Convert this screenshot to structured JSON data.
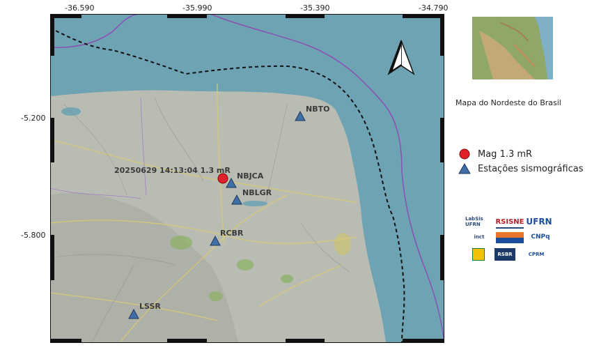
{
  "map": {
    "top_ticks": [
      "-36.590",
      "-35.990",
      "-35.390",
      "-34.790"
    ],
    "left_ticks": [
      "-5.200",
      "-5.800"
    ],
    "north_arrow": "north-arrow-icon",
    "event_label": "20250629 14:13:04 1.3 mR",
    "stations": [
      {
        "code": "NBTO"
      },
      {
        "code": "NBJCA"
      },
      {
        "code": "NBLGR"
      },
      {
        "code": "RCBR"
      },
      {
        "code": "LSSR"
      }
    ],
    "colors": {
      "ocean": "#6ea3b3",
      "land": "#b9bcb3",
      "event": "#e0202a",
      "station": "#3f6fa6",
      "coast_line": "#8a4fb5"
    }
  },
  "inset": {
    "caption": "Mapa do  Nordeste do Brasil"
  },
  "legend": {
    "event_label": "Mag 1.3 mR",
    "station_label": "Estações sismográficas"
  },
  "logos": {
    "labsis": "LabSis UFRN",
    "rsisne": "RSISNE",
    "ufrn": "UFRN",
    "inct": "inct",
    "cnpq": "CNPq",
    "rsbr": "RSBR",
    "cprm": "CPRM"
  }
}
